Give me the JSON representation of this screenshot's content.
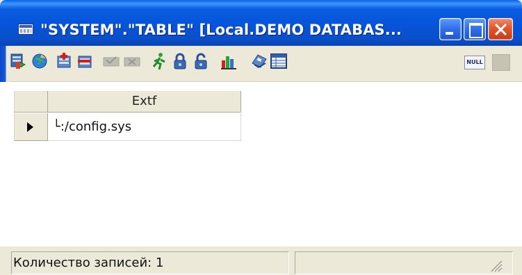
{
  "window": {
    "title": "\"SYSTEM\".\"TABLE\" [Local.DEMO DATABAS...",
    "controls": [
      "minimize",
      "maximize",
      "close"
    ]
  },
  "toolbar": {
    "buttons": [
      {
        "name": "refresh-data",
        "icon": "refresh-icon",
        "enabled": true
      },
      {
        "name": "navigate",
        "icon": "globe-icon",
        "enabled": true
      },
      {
        "name": "insert-record",
        "icon": "add-record-icon",
        "enabled": true
      },
      {
        "name": "delete-record",
        "icon": "delete-record-icon",
        "enabled": true
      },
      {
        "name": "post-edit",
        "icon": "post-icon",
        "enabled": false
      },
      {
        "name": "cancel-edit",
        "icon": "cancel-icon",
        "enabled": false
      },
      {
        "name": "run",
        "icon": "running-man-icon",
        "enabled": true
      },
      {
        "name": "lock",
        "icon": "lock-icon",
        "enabled": true
      },
      {
        "name": "unlock",
        "icon": "lock-open-icon",
        "enabled": true
      },
      {
        "name": "chart",
        "icon": "chart-icon",
        "enabled": true
      },
      {
        "name": "print",
        "icon": "printer-icon",
        "enabled": true
      },
      {
        "name": "grid-view",
        "icon": "grid-icon",
        "enabled": true
      }
    ],
    "null_label": "NULL"
  },
  "grid": {
    "columns": [
      "Extf"
    ],
    "rows": [
      {
        "values": [
          "└:/config.sys"
        ],
        "current": true
      }
    ]
  },
  "statusbar": {
    "record_count_text": "Количество записей: 1"
  },
  "colors": {
    "titlebar": "#0554d9",
    "close_button": "#e0562e",
    "chrome": "#ece9d8"
  }
}
